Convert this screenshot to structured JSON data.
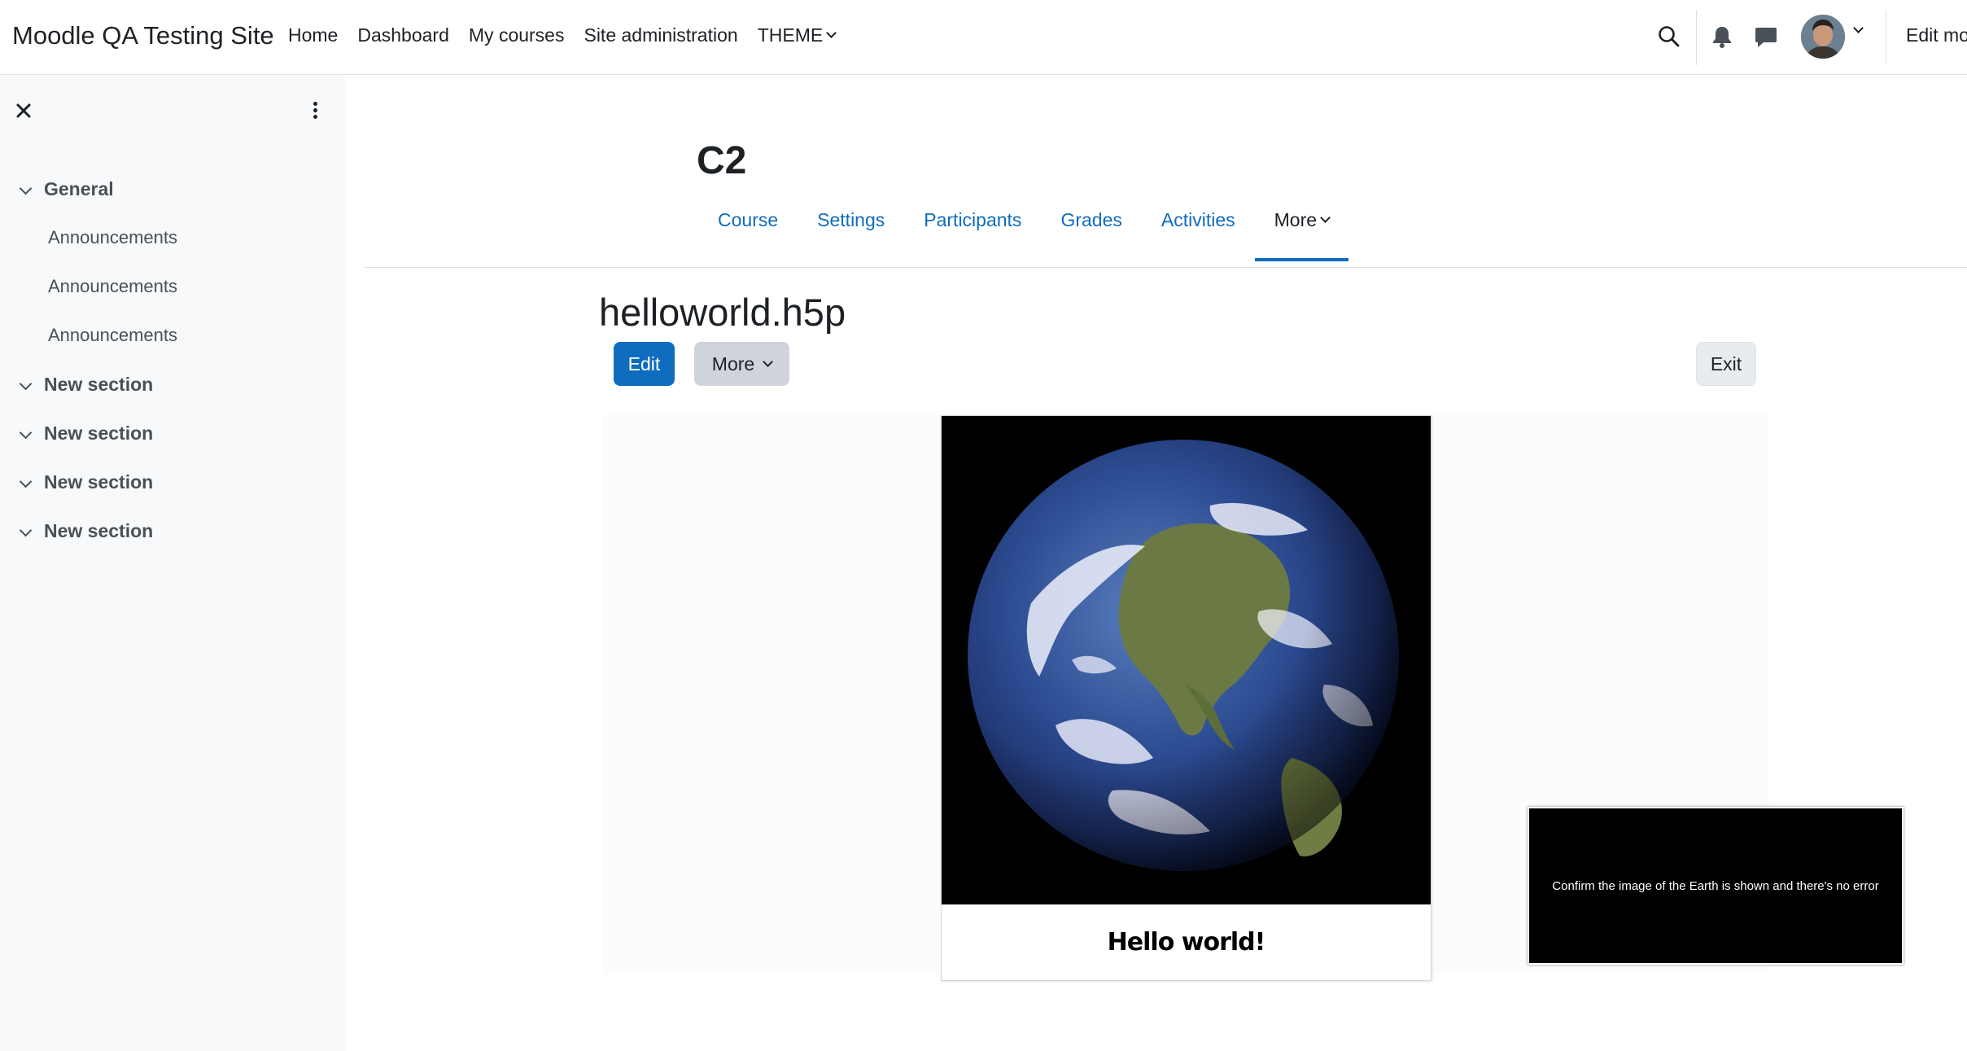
{
  "navbar": {
    "site_name": "Moodle QA Testing Site",
    "items": [
      {
        "label": "Home"
      },
      {
        "label": "Dashboard"
      },
      {
        "label": "My courses"
      },
      {
        "label": "Site administration"
      },
      {
        "label": "THEME"
      }
    ],
    "edit_mode_label": "Edit mo"
  },
  "course_index": {
    "sections": [
      {
        "label": "General",
        "items": [
          "Announcements",
          "Announcements",
          "Announcements"
        ]
      },
      {
        "label": "New section"
      },
      {
        "label": "New section"
      },
      {
        "label": "New section"
      },
      {
        "label": "New section"
      }
    ]
  },
  "course": {
    "title": "C2",
    "tabs": [
      {
        "label": "Course"
      },
      {
        "label": "Settings"
      },
      {
        "label": "Participants"
      },
      {
        "label": "Grades"
      },
      {
        "label": "Activities"
      },
      {
        "label": "More"
      }
    ]
  },
  "activity": {
    "title": "helloworld.h5p",
    "edit_label": "Edit",
    "more_label": "More",
    "exit_label": "Exit"
  },
  "h5p": {
    "caption": "Hello world!",
    "instruction": "Confirm the image of the Earth is shown and there's no error"
  },
  "colors": {
    "primary": "#0f6cbf",
    "drawer_bg": "#f8f9fa",
    "text": "#1d2125"
  }
}
